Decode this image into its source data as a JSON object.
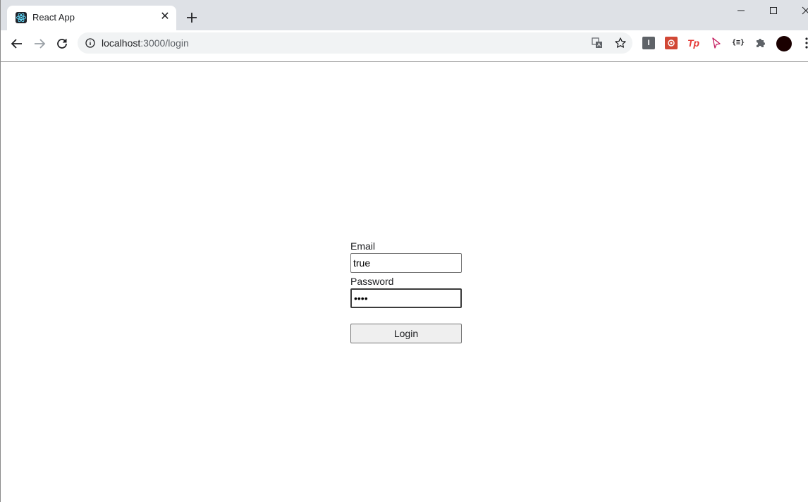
{
  "browser": {
    "tab": {
      "title": "React App",
      "favicon": "react-logo-icon",
      "close": "✕"
    },
    "new_tab": "plus-icon",
    "url": {
      "host": "localhost",
      "path": ":3000/login"
    },
    "extensions": {
      "ext1_label": "I",
      "ext3_label": "Tp",
      "ext5_label": "{≡}"
    }
  },
  "login_form": {
    "email": {
      "label": "Email",
      "value": "true"
    },
    "password": {
      "label": "Password",
      "value": "1234"
    },
    "submit_label": "Login"
  }
}
